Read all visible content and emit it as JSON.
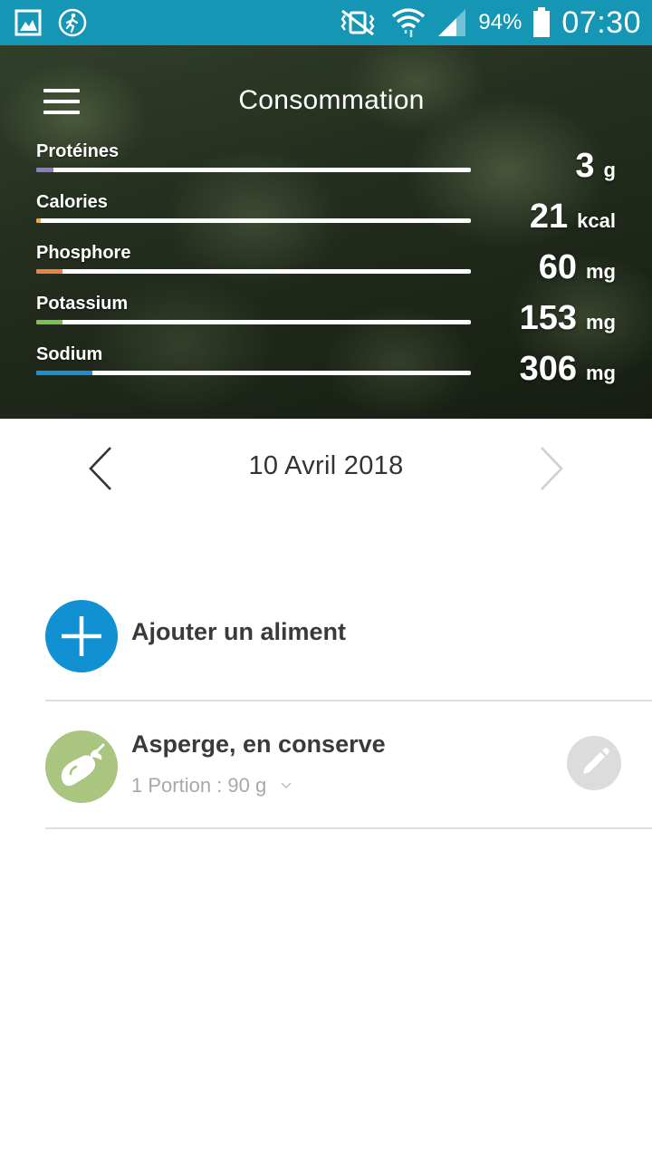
{
  "status_bar": {
    "battery": "94%",
    "time": "07:30"
  },
  "header": {
    "title": "Consommation",
    "nutrients": [
      {
        "label": "Protéines",
        "value": "3",
        "unit": "g",
        "color": "#8e7cc3",
        "fill_fraction": 0.04
      },
      {
        "label": "Calories",
        "value": "21",
        "unit": "kcal",
        "color": "#f0a640",
        "fill_fraction": 0.01
      },
      {
        "label": "Phosphore",
        "value": "60",
        "unit": "mg",
        "color": "#e8834a",
        "fill_fraction": 0.06
      },
      {
        "label": "Potassium",
        "value": "153",
        "unit": "mg",
        "color": "#7cc04f",
        "fill_fraction": 0.06
      },
      {
        "label": "Sodium",
        "value": "306",
        "unit": "mg",
        "color": "#1a8fd6",
        "fill_fraction": 0.13
      }
    ]
  },
  "date_nav": {
    "date": "10 Avril 2018"
  },
  "add_food": {
    "label": "Ajouter un aliment"
  },
  "food_items": [
    {
      "name": "Asperge, en conserve",
      "portion": "1 Portion : 90 g"
    }
  ],
  "colors": {
    "status_bar": "#1496b4",
    "accent": "#1191d4",
    "food_icon_bg": "#a9c580"
  }
}
